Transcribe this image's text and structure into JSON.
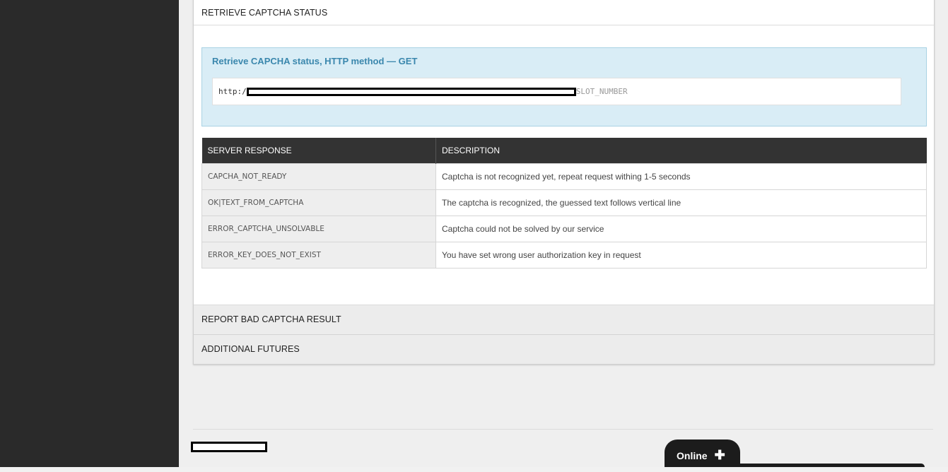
{
  "sections": {
    "retrieve_status_title": "RETRIEVE CAPTCHA STATUS",
    "report_bad_title": "REPORT BAD CAPTCHA RESULT",
    "additional_title": "ADDITIONAL FUTURES"
  },
  "info_box": {
    "title": "Retrieve CAPCHA status, HTTP method — GET",
    "url_prefix": "http:/",
    "url_suffix": "SLOT_NUMBER"
  },
  "table": {
    "headers": [
      "SERVER RESPONSE",
      "DESCRIPTION"
    ],
    "rows": [
      {
        "code": "CAPCHA_NOT_READY",
        "desc": "Captcha is not recognized yet, repeat request withing 1-5 seconds"
      },
      {
        "code": "OK|TEXT_FROM_CAPTCHA",
        "desc": "The captcha is recognized, the guessed text follows vertical line"
      },
      {
        "code": "ERROR_CAPTCHA_UNSOLVABLE",
        "desc": "Captcha could not be solved by our service"
      },
      {
        "code": "ERROR_KEY_DOES_NOT_EXIST",
        "desc": "You have set wrong user authorization key in request"
      }
    ]
  },
  "chat": {
    "label": "Online",
    "plus": "✚"
  },
  "colors": {
    "sidebar": "#2a2a2a",
    "info_bg": "#d9edf6",
    "info_title": "#3a87ad",
    "table_header": "#333333"
  }
}
